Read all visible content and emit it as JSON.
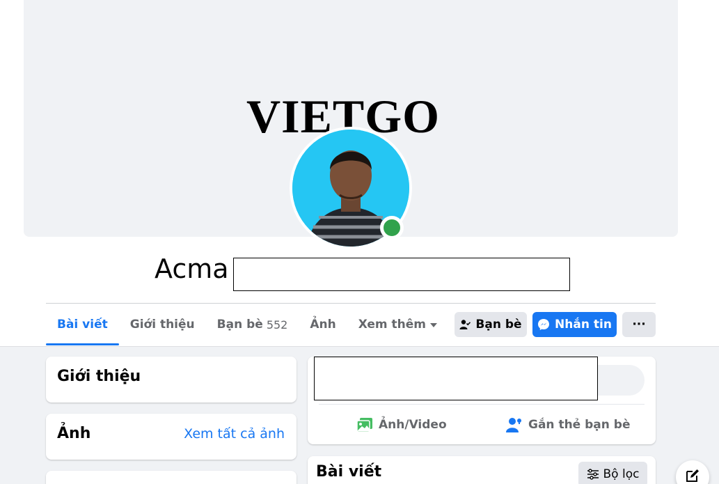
{
  "cover": {
    "logo_text": "VIETGO"
  },
  "profile": {
    "name": "Acma"
  },
  "tabs": [
    {
      "label": "Bài viết",
      "active": true
    },
    {
      "label": "Giới thiệu"
    },
    {
      "label": "Bạn bè",
      "count": "552"
    },
    {
      "label": "Ảnh"
    },
    {
      "label": "Xem thêm",
      "icon": "caret-down-icon"
    }
  ],
  "actions": {
    "friends_label": "Bạn bè",
    "friends_icon": "friend-check-icon",
    "message_label": "Nhắn tin",
    "message_icon": "messenger-icon",
    "more_label": "···"
  },
  "sidebar": {
    "intro_title": "Giới thiệu",
    "photos_title": "Ảnh",
    "photos_see_all": "Xem tất cả ảnh"
  },
  "composer": {
    "photo_video_label": "Ảnh/Video",
    "tag_friends_label": "Gắn thẻ bạn bè"
  },
  "posts": {
    "title": "Bài viết",
    "filter_label": "Bộ lọc"
  },
  "colors": {
    "accent": "#1877f2",
    "online": "#31a24c",
    "photo_icon": "#45bd62"
  }
}
